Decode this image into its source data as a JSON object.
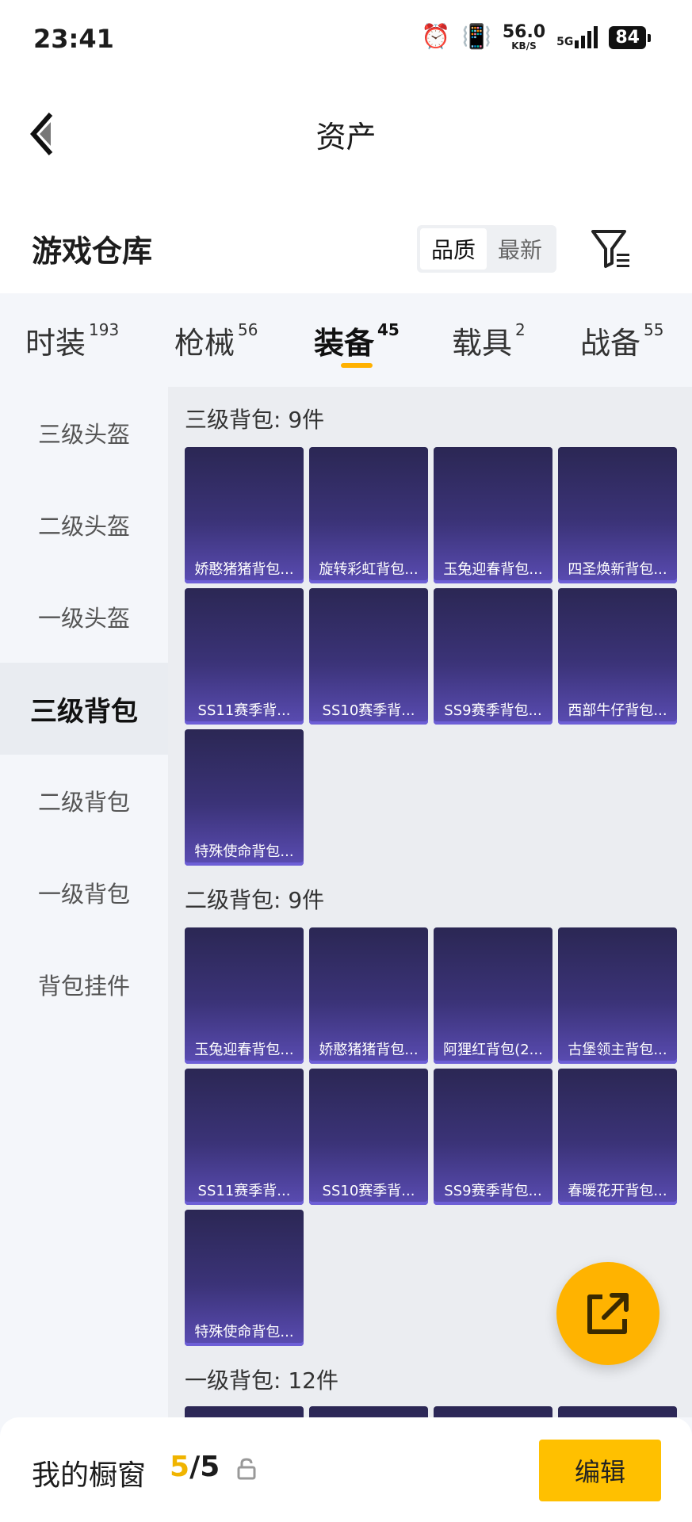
{
  "status_bar": {
    "time": "23:41",
    "net_speed": "56.0",
    "net_unit": "KB/S",
    "network": "5G",
    "battery": "84"
  },
  "header": {
    "title": "资产"
  },
  "warehouse": {
    "title": "游戏仓库",
    "sort_options": [
      "品质",
      "最新"
    ],
    "sort_selected": "品质"
  },
  "tabs": [
    {
      "label": "时装",
      "count": "193"
    },
    {
      "label": "枪械",
      "count": "56"
    },
    {
      "label": "装备",
      "count": "45"
    },
    {
      "label": "载具",
      "count": "2"
    },
    {
      "label": "战备",
      "count": "55"
    }
  ],
  "active_tab": "装备",
  "sidebar": {
    "items": [
      "三级头盔",
      "二级头盔",
      "一级头盔",
      "三级背包",
      "二级背包",
      "一级背包",
      "背包挂件"
    ],
    "active": "三级背包"
  },
  "sections": [
    {
      "title": "三级背包: 9件",
      "items": [
        "娇憨猪猪背包...",
        "旋转彩虹背包...",
        "玉兔迎春背包...",
        "四圣焕新背包...",
        "SS11赛季背...",
        "SS10赛季背...",
        "SS9赛季背包...",
        "西部牛仔背包...",
        "特殊使命背包..."
      ]
    },
    {
      "title": "二级背包: 9件",
      "items": [
        "玉兔迎春背包...",
        "娇憨猪猪背包...",
        "阿狸红背包(2...",
        "古堡领主背包...",
        "SS11赛季背...",
        "SS10赛季背...",
        "SS9赛季背包...",
        "春暖花开背包...",
        "特殊使命背包..."
      ]
    },
    {
      "title": "一级背包: 12件",
      "items": []
    }
  ],
  "bottom_bar": {
    "label": "我的橱窗",
    "count_current": "5",
    "count_total": "/5",
    "edit_label": "编辑"
  },
  "colors": {
    "accent": "#ffb100",
    "card_top": "#2b2754",
    "card_bottom": "#5a4cb3"
  }
}
